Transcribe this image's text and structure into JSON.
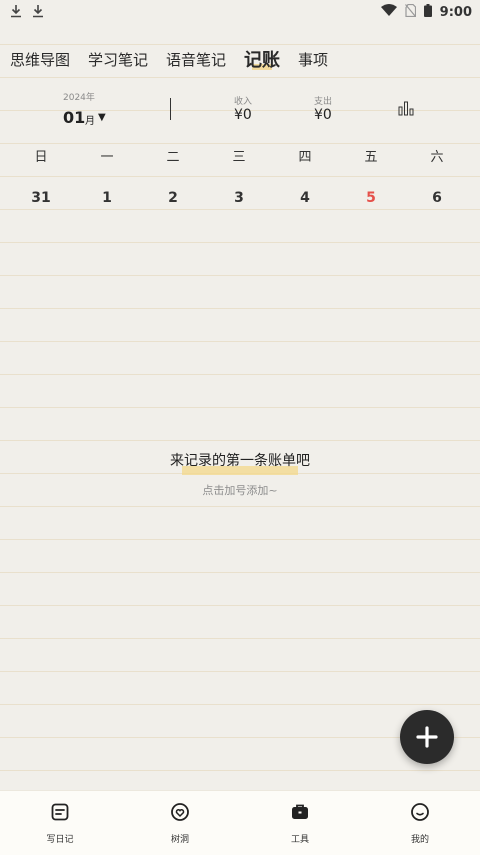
{
  "status_bar": {
    "time": "9:00",
    "left_icons": [
      "download-icon",
      "download-icon"
    ],
    "right_icons": [
      "wifi-icon",
      "no-sim-icon",
      "battery-icon"
    ]
  },
  "tabs": [
    {
      "label": "思维导图",
      "active": false
    },
    {
      "label": "学习笔记",
      "active": false
    },
    {
      "label": "语音笔记",
      "active": false
    },
    {
      "label": "记账",
      "active": true
    },
    {
      "label": "事项",
      "active": false
    }
  ],
  "summary": {
    "year": "2024年",
    "month": "01",
    "month_unit": "月",
    "income_label": "收入",
    "income_value": "¥0",
    "expense_label": "支出",
    "expense_value": "¥0"
  },
  "week_days": [
    "日",
    "一",
    "二",
    "三",
    "四",
    "五",
    "六"
  ],
  "days": [
    "31",
    "1",
    "2",
    "3",
    "4",
    "5",
    "6"
  ],
  "today": "5",
  "colors": {
    "today": "#e5504a",
    "highlight": "#f3d88a",
    "fab": "#2b2b2b"
  },
  "empty_state": {
    "title": "来记录的第一条账单吧",
    "subtitle": "点击加号添加~"
  },
  "bottom_nav": [
    {
      "label": "写日记",
      "icon": "note-icon"
    },
    {
      "label": "树洞",
      "icon": "heart-bubble-icon"
    },
    {
      "label": "工具",
      "icon": "toolbox-icon"
    },
    {
      "label": "我的",
      "icon": "smile-icon"
    }
  ]
}
